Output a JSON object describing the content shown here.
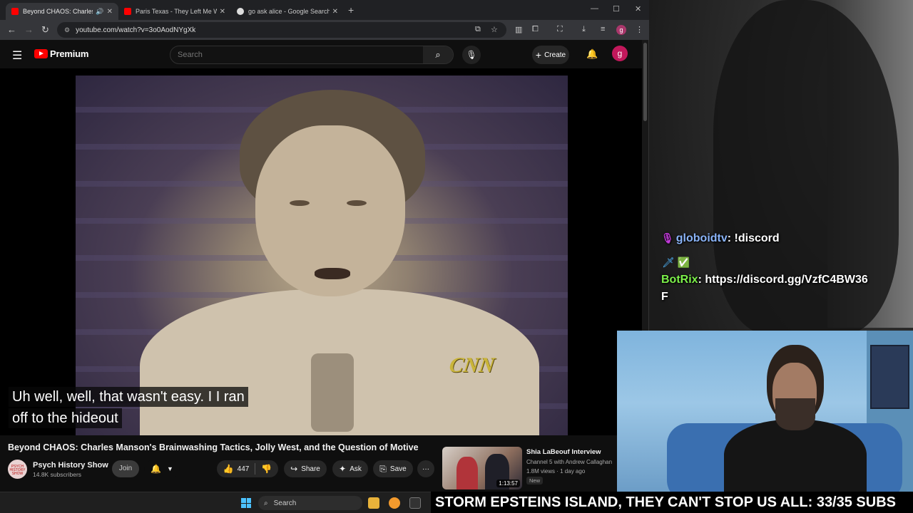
{
  "browser": {
    "tabs": [
      {
        "title": "Beyond CHAOS: Charles M",
        "active": true,
        "audio": true,
        "favicon_color": "#ff0000"
      },
      {
        "title": "Paris Texas - They Left Me With",
        "active": false,
        "audio": false,
        "favicon_color": "#ff0000"
      },
      {
        "title": "go ask alice - Google Search",
        "active": false,
        "audio": false,
        "favicon_color": "#dddddd"
      }
    ],
    "new_tab": "+",
    "url": "youtube.com/watch?v=3o0AodNYgXk",
    "profile_initial": "g"
  },
  "youtube": {
    "logo_text": "Premium",
    "search_placeholder": "Search",
    "create_label": "Create",
    "avatar_initial": "g",
    "captions": [
      "Uh well, well, that wasn't easy. I I ran",
      "off to the hideout"
    ],
    "watermark": "CNN",
    "video_title": "Beyond CHAOS: Charles Manson's Brainwashing Tactics, Jolly West, and the Question of Motive",
    "channel": {
      "name": "Psych History Show",
      "subscribers": "14.8K subscribers",
      "avatar_text": "PSYCH HISTORY SHOW"
    },
    "join_label": "Join",
    "like_count": "447",
    "share_label": "Share",
    "ask_label": "Ask",
    "save_label": "Save",
    "more_label": "···",
    "recommended": {
      "title": "Shia LaBeouf Interview",
      "channel": "Channel 5 with Andrew Callaghan",
      "meta": "1.8M views · 1 day ago",
      "badge": "New",
      "duration": "1:13:57"
    }
  },
  "stream": {
    "chat": [
      {
        "user": "globoidtv",
        "message": "!discord",
        "color": "#8ab4f8"
      },
      {
        "user": "BotRix",
        "message": "https://discord.gg/VzfC4BW36",
        "color": "#7cf04a"
      },
      {
        "user": "",
        "message": "F",
        "color": "#ffffff"
      }
    ],
    "ticker": "STORM EPSTEINS ISLAND, THEY CAN'T STOP US ALL: 33/35 SUBS"
  },
  "taskbar": {
    "search_placeholder": "Search"
  }
}
